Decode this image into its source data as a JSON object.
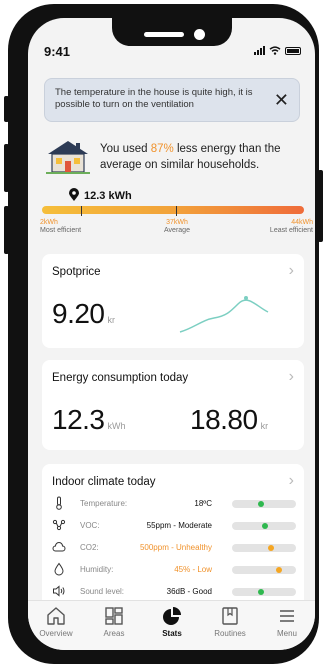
{
  "status_bar": {
    "time": "9:41"
  },
  "notification": {
    "message": "The temperature in the house is quite high, it is possible to turn on the ventilation",
    "close_label": "✕"
  },
  "energy_summary": {
    "text_before": "You used ",
    "highlight": "87%",
    "text_after": " less energy than the average on similar households.",
    "current_label": "12.3 kWh",
    "current_value_kwh": 12.3,
    "scale": {
      "min": {
        "value": "2kWh",
        "label": "Most efficient"
      },
      "mid": {
        "value": "37kWh",
        "label": "Average"
      },
      "max": {
        "value": "44kWh",
        "label": "Least efficient"
      }
    }
  },
  "spotprice": {
    "title": "Spotprice",
    "value": "9.20",
    "unit": "kr"
  },
  "consumption": {
    "title": "Energy consumption today",
    "energy_value": "12.3",
    "energy_unit": "kWh",
    "cost_value": "18.80",
    "cost_unit": "kr"
  },
  "climate": {
    "title": "Indoor climate today",
    "rows": [
      {
        "icon": "thermometer-icon",
        "label": "Temperature:",
        "value": "18ºC",
        "level": 0.45,
        "status": "good"
      },
      {
        "icon": "molecule-icon",
        "label": "VOC:",
        "value": "55ppm - Moderate",
        "level": 0.52,
        "status": "good"
      },
      {
        "icon": "cloud-icon",
        "label": "CO2:",
        "value": "500ppm - Unhealthy",
        "level": 0.62,
        "status": "warn"
      },
      {
        "icon": "droplet-icon",
        "label": "Humidity:",
        "value": "45% - Low",
        "level": 0.75,
        "status": "warn"
      },
      {
        "icon": "speaker-icon",
        "label": "Sound level:",
        "value": "36dB - Good",
        "level": 0.45,
        "status": "good"
      }
    ]
  },
  "tabs": [
    {
      "label": "Overview",
      "icon": "home-icon",
      "active": false
    },
    {
      "label": "Areas",
      "icon": "grid-icon",
      "active": false
    },
    {
      "label": "Stats",
      "icon": "pie-chart-icon",
      "active": true
    },
    {
      "label": "Routines",
      "icon": "bookmark-icon",
      "active": false
    },
    {
      "label": "Menu",
      "icon": "menu-icon",
      "active": false
    }
  ],
  "colors": {
    "accent_orange": "#f0922c",
    "good_green": "#2fb84f",
    "warn_orange": "#f5a623",
    "chart_line": "#7ccfc2"
  }
}
